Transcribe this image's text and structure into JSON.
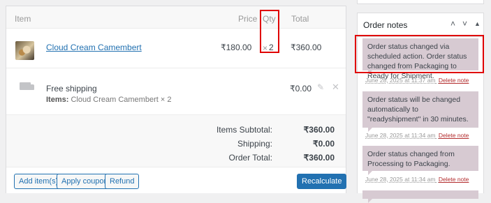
{
  "items_header": {
    "item": "Item",
    "price": "Price",
    "qty": "Qty",
    "total": "Total"
  },
  "line_item": {
    "name": "Cloud Cream Camembert",
    "price": "₹180.00",
    "qty_prefix": "×",
    "qty": "2",
    "total": "₹360.00"
  },
  "shipping": {
    "name": "Free shipping",
    "items_label": "Items:",
    "items_value": "Cloud Cream Camembert × 2",
    "cost": "₹0.00"
  },
  "totals": {
    "subtotal_label": "Items Subtotal:",
    "subtotal_value": "₹360.00",
    "shipping_label": "Shipping:",
    "shipping_value": "₹0.00",
    "order_total_label": "Order Total:",
    "order_total_value": "₹360.00"
  },
  "actions": {
    "add_items": "Add item(s)",
    "apply_coupon": "Apply coupon",
    "refund": "Refund",
    "recalculate": "Recalculate"
  },
  "notes": {
    "title": "Order notes",
    "icons": [
      "chevron-up-icon",
      "chevron-down-icon",
      "triangle-up-icon"
    ],
    "delete_label": "Delete note",
    "items": [
      {
        "text": "Order status changed via scheduled action. Order status changed from Packaging to Ready for Shipment.",
        "date": "June 28, 2025 at 11:37 am"
      },
      {
        "text": "Order status will be changed automatically to \"readyshipment\" in 30 minutes.",
        "date": "June 28, 2025 at 11:34 am"
      },
      {
        "text": "Order status changed from Processing to Packaging.",
        "date": "June 28, 2025 at 11:34 am"
      }
    ]
  },
  "colors": {
    "highlight": "#e00000",
    "note_bg": "#d7cad2",
    "link": "#2271b1",
    "delete": "#b32d2e"
  }
}
